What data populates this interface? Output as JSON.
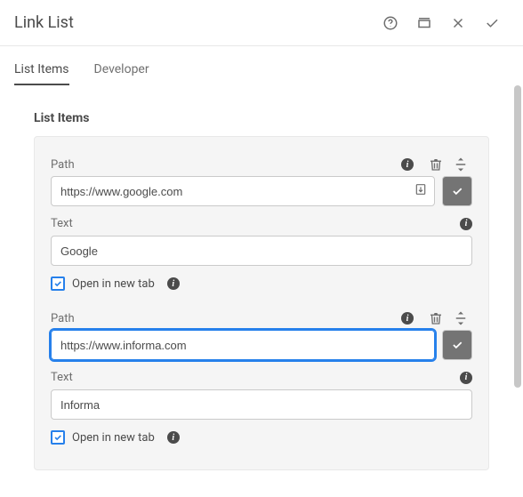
{
  "dialog": {
    "title": "Link List",
    "tabs": {
      "list_items": "List Items",
      "developer": "Developer"
    }
  },
  "section": {
    "heading": "List Items"
  },
  "labels": {
    "path": "Path",
    "text": "Text",
    "open_new_tab": "Open in new tab"
  },
  "items": [
    {
      "path": "https://www.google.com",
      "text": "Google",
      "open_new_tab": true
    },
    {
      "path": "https://www.informa.com",
      "text": "Informa",
      "open_new_tab": true
    }
  ]
}
